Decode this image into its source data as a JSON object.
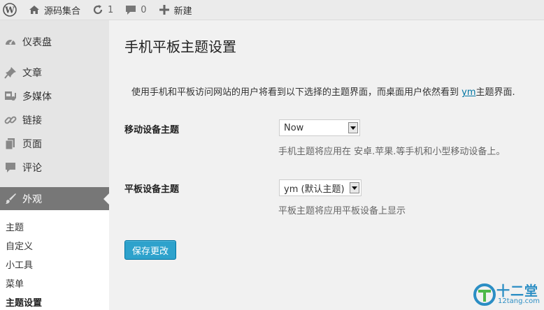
{
  "adminbar": {
    "site_name": "源码集合",
    "updates_count": "1",
    "comments_count": "0",
    "new_label": "新建"
  },
  "sidebar": {
    "items": [
      {
        "label": "仪表盘",
        "icon": "dashboard-icon"
      },
      {
        "label": "文章",
        "icon": "pin-icon"
      },
      {
        "label": "多媒体",
        "icon": "media-icon"
      },
      {
        "label": "链接",
        "icon": "link-icon"
      },
      {
        "label": "页面",
        "icon": "page-icon"
      },
      {
        "label": "评论",
        "icon": "comment-icon"
      },
      {
        "label": "外观",
        "icon": "brush-icon"
      }
    ],
    "submenu": [
      "主题",
      "自定义",
      "小工具",
      "菜单",
      "主题设置"
    ]
  },
  "main": {
    "title": "手机平板主题设置",
    "description_before": "使用手机和平板访问网站的用户将看到以下选择的主题界面，而桌面用户依然看到 ",
    "description_link": "ym",
    "description_after": "主题界面.",
    "mobile": {
      "label": "移动设备主题",
      "selected": "Now",
      "help": "手机主题将应用在 安卓.苹果.等手机和小型移动设备上。"
    },
    "tablet": {
      "label": "平板设备主题",
      "selected": "ym (默认主题)",
      "help": "平板主题将应用平板设备上显示"
    },
    "save_label": "保存更改"
  },
  "watermark": {
    "text": "十二堂",
    "url": "12tang.com"
  },
  "colors": {
    "accent": "#2ea2cc",
    "link": "#0074a2",
    "sidebar_bg": "#e5e5e5",
    "current_menu_bg": "#777777"
  }
}
